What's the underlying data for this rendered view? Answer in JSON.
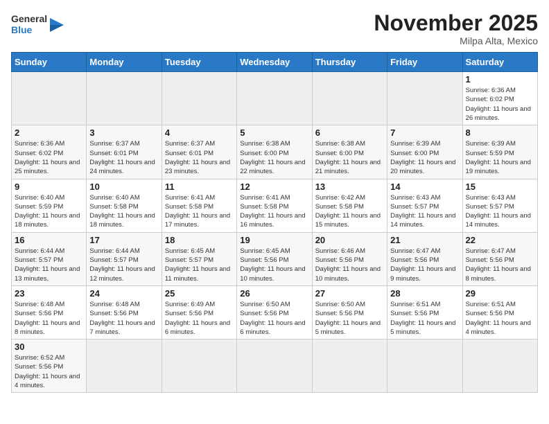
{
  "header": {
    "logo_general": "General",
    "logo_blue": "Blue",
    "month_title": "November 2025",
    "location": "Milpa Alta, Mexico"
  },
  "weekdays": [
    "Sunday",
    "Monday",
    "Tuesday",
    "Wednesday",
    "Thursday",
    "Friday",
    "Saturday"
  ],
  "weeks": [
    [
      {
        "day": "",
        "info": ""
      },
      {
        "day": "",
        "info": ""
      },
      {
        "day": "",
        "info": ""
      },
      {
        "day": "",
        "info": ""
      },
      {
        "day": "",
        "info": ""
      },
      {
        "day": "",
        "info": ""
      },
      {
        "day": "1",
        "info": "Sunrise: 6:36 AM\nSunset: 6:02 PM\nDaylight: 11 hours\nand 26 minutes."
      }
    ],
    [
      {
        "day": "2",
        "info": "Sunrise: 6:36 AM\nSunset: 6:02 PM\nDaylight: 11 hours\nand 25 minutes."
      },
      {
        "day": "3",
        "info": "Sunrise: 6:37 AM\nSunset: 6:01 PM\nDaylight: 11 hours\nand 24 minutes."
      },
      {
        "day": "4",
        "info": "Sunrise: 6:37 AM\nSunset: 6:01 PM\nDaylight: 11 hours\nand 23 minutes."
      },
      {
        "day": "5",
        "info": "Sunrise: 6:38 AM\nSunset: 6:00 PM\nDaylight: 11 hours\nand 22 minutes."
      },
      {
        "day": "6",
        "info": "Sunrise: 6:38 AM\nSunset: 6:00 PM\nDaylight: 11 hours\nand 21 minutes."
      },
      {
        "day": "7",
        "info": "Sunrise: 6:39 AM\nSunset: 6:00 PM\nDaylight: 11 hours\nand 20 minutes."
      },
      {
        "day": "8",
        "info": "Sunrise: 6:39 AM\nSunset: 5:59 PM\nDaylight: 11 hours\nand 19 minutes."
      }
    ],
    [
      {
        "day": "9",
        "info": "Sunrise: 6:40 AM\nSunset: 5:59 PM\nDaylight: 11 hours\nand 18 minutes."
      },
      {
        "day": "10",
        "info": "Sunrise: 6:40 AM\nSunset: 5:58 PM\nDaylight: 11 hours\nand 18 minutes."
      },
      {
        "day": "11",
        "info": "Sunrise: 6:41 AM\nSunset: 5:58 PM\nDaylight: 11 hours\nand 17 minutes."
      },
      {
        "day": "12",
        "info": "Sunrise: 6:41 AM\nSunset: 5:58 PM\nDaylight: 11 hours\nand 16 minutes."
      },
      {
        "day": "13",
        "info": "Sunrise: 6:42 AM\nSunset: 5:58 PM\nDaylight: 11 hours\nand 15 minutes."
      },
      {
        "day": "14",
        "info": "Sunrise: 6:43 AM\nSunset: 5:57 PM\nDaylight: 11 hours\nand 14 minutes."
      },
      {
        "day": "15",
        "info": "Sunrise: 6:43 AM\nSunset: 5:57 PM\nDaylight: 11 hours\nand 14 minutes."
      }
    ],
    [
      {
        "day": "16",
        "info": "Sunrise: 6:44 AM\nSunset: 5:57 PM\nDaylight: 11 hours\nand 13 minutes."
      },
      {
        "day": "17",
        "info": "Sunrise: 6:44 AM\nSunset: 5:57 PM\nDaylight: 11 hours\nand 12 minutes."
      },
      {
        "day": "18",
        "info": "Sunrise: 6:45 AM\nSunset: 5:57 PM\nDaylight: 11 hours\nand 11 minutes."
      },
      {
        "day": "19",
        "info": "Sunrise: 6:45 AM\nSunset: 5:56 PM\nDaylight: 11 hours\nand 10 minutes."
      },
      {
        "day": "20",
        "info": "Sunrise: 6:46 AM\nSunset: 5:56 PM\nDaylight: 11 hours\nand 10 minutes."
      },
      {
        "day": "21",
        "info": "Sunrise: 6:47 AM\nSunset: 5:56 PM\nDaylight: 11 hours\nand 9 minutes."
      },
      {
        "day": "22",
        "info": "Sunrise: 6:47 AM\nSunset: 5:56 PM\nDaylight: 11 hours\nand 8 minutes."
      }
    ],
    [
      {
        "day": "23",
        "info": "Sunrise: 6:48 AM\nSunset: 5:56 PM\nDaylight: 11 hours\nand 8 minutes."
      },
      {
        "day": "24",
        "info": "Sunrise: 6:48 AM\nSunset: 5:56 PM\nDaylight: 11 hours\nand 7 minutes."
      },
      {
        "day": "25",
        "info": "Sunrise: 6:49 AM\nSunset: 5:56 PM\nDaylight: 11 hours\nand 6 minutes."
      },
      {
        "day": "26",
        "info": "Sunrise: 6:50 AM\nSunset: 5:56 PM\nDaylight: 11 hours\nand 6 minutes."
      },
      {
        "day": "27",
        "info": "Sunrise: 6:50 AM\nSunset: 5:56 PM\nDaylight: 11 hours\nand 5 minutes."
      },
      {
        "day": "28",
        "info": "Sunrise: 6:51 AM\nSunset: 5:56 PM\nDaylight: 11 hours\nand 5 minutes."
      },
      {
        "day": "29",
        "info": "Sunrise: 6:51 AM\nSunset: 5:56 PM\nDaylight: 11 hours\nand 4 minutes."
      }
    ],
    [
      {
        "day": "30",
        "info": "Sunrise: 6:52 AM\nSunset: 5:56 PM\nDaylight: 11 hours\nand 4 minutes."
      },
      {
        "day": "",
        "info": ""
      },
      {
        "day": "",
        "info": ""
      },
      {
        "day": "",
        "info": ""
      },
      {
        "day": "",
        "info": ""
      },
      {
        "day": "",
        "info": ""
      },
      {
        "day": "",
        "info": ""
      }
    ]
  ]
}
